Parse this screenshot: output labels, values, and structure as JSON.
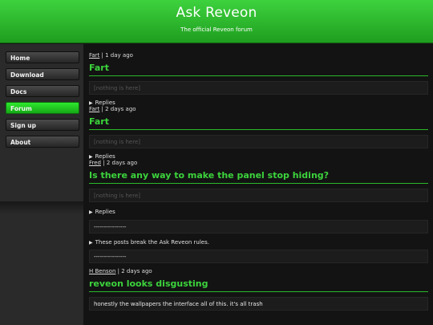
{
  "header": {
    "title": "Ask Reveon",
    "subtitle": "The official Reveon forum"
  },
  "nav": {
    "items": [
      {
        "label": "Home"
      },
      {
        "label": "Download"
      },
      {
        "label": "Docs"
      },
      {
        "label": "Forum"
      },
      {
        "label": "Sign up"
      },
      {
        "label": "About"
      }
    ],
    "active": "Forum"
  },
  "posts": [
    {
      "author": "Fart",
      "time": "1 day ago",
      "title": "Fart",
      "body": "[nothing is here]",
      "replies_label": "Replies"
    },
    {
      "author": "Fart",
      "time": "2 days ago",
      "title": "Fart",
      "body": "[nothing is here]",
      "replies_label": "Replies"
    },
    {
      "author": "Fred",
      "time": "2 days ago",
      "title": "Is there any way to make the panel stop hiding?",
      "body": "[nothing is here]",
      "replies_label": "Replies",
      "reply_box_1": "----------------",
      "rules_note": "These posts break the Ask Reveon rules.",
      "reply_box_2": "----------------"
    },
    {
      "author": "H Benson",
      "time": "2 days ago",
      "title": "reveon looks disgusting",
      "body": "honestly the wallpapers the interface all of this. it's all trash"
    }
  ],
  "separator": "|",
  "icons": {
    "disclosure": "triangle-right-icon"
  },
  "colors": {
    "accent": "#3cd33c",
    "header_top": "#3ed23e",
    "header_bottom": "#1f9e1f"
  }
}
